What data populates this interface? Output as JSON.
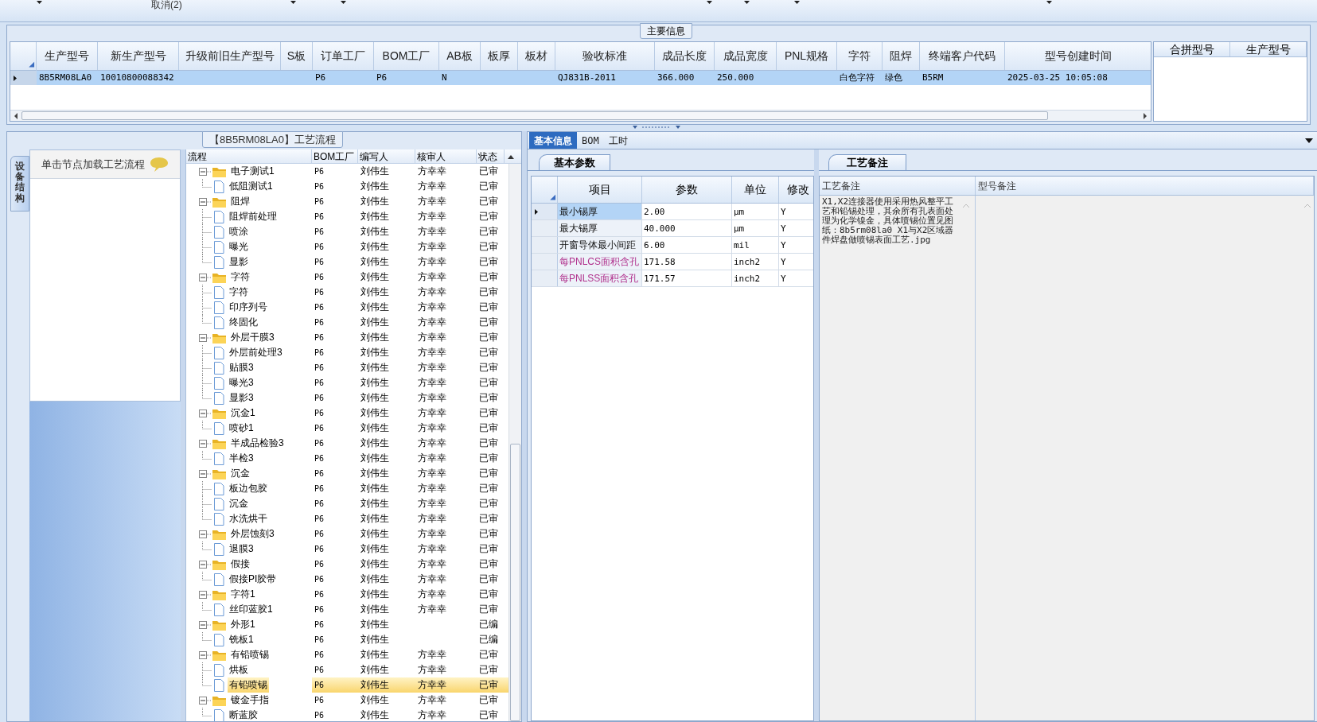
{
  "toolbar": {
    "cancel_label": "取消(2)"
  },
  "main_info": {
    "title": "主要信息",
    "columns": [
      "生产型号",
      "新生产型号",
      "升级前旧生产型号",
      "S板",
      "订单工厂",
      "BOM工厂",
      "AB板",
      "板厚",
      "板材",
      "验收标准",
      "成品长度",
      "成品宽度",
      "PNL规格",
      "字符",
      "阻焊",
      "终端客户代码",
      "型号创建时间"
    ],
    "rows": [
      {
        "selected": true,
        "cells": [
          "8B5RM08LA0",
          "10010800088342",
          "",
          "",
          "P6",
          "P6",
          "N",
          "",
          "",
          "QJ831B-2011",
          "366.000",
          "250.000",
          "",
          "白色字符",
          "绿色",
          "B5RM",
          "2025-03-25 10:05:08"
        ]
      }
    ],
    "side_columns": [
      "合拼型号",
      "生产型号"
    ]
  },
  "process": {
    "title": "【8B5RM08LA0】工艺流程",
    "side_tab": "设备结构",
    "hint": "单击节点加载工艺流程",
    "columns": [
      "流程",
      "BOM工厂",
      "编写人",
      "核审人",
      "状态"
    ],
    "nodes": [
      {
        "name": "电子测试1",
        "bom": "P6",
        "author": "刘伟生",
        "reviewer": "方幸幸",
        "status": "已审",
        "selected": false,
        "expanded": true,
        "children": [
          {
            "name": "低阻测试1",
            "bom": "P6",
            "author": "刘伟生",
            "reviewer": "方幸幸",
            "status": "已审",
            "selected": false
          }
        ]
      },
      {
        "name": "阻焊",
        "bom": "P6",
        "author": "刘伟生",
        "reviewer": "方幸幸",
        "status": "已审",
        "selected": false,
        "expanded": true,
        "children": [
          {
            "name": "阻焊前处理",
            "bom": "P6",
            "author": "刘伟生",
            "reviewer": "方幸幸",
            "status": "已审",
            "selected": false
          },
          {
            "name": "喷涂",
            "bom": "P6",
            "author": "刘伟生",
            "reviewer": "方幸幸",
            "status": "已审",
            "selected": false
          },
          {
            "name": "曝光",
            "bom": "P6",
            "author": "刘伟生",
            "reviewer": "方幸幸",
            "status": "已审",
            "selected": false
          },
          {
            "name": "显影",
            "bom": "P6",
            "author": "刘伟生",
            "reviewer": "方幸幸",
            "status": "已审",
            "selected": false
          }
        ]
      },
      {
        "name": "字符",
        "bom": "P6",
        "author": "刘伟生",
        "reviewer": "方幸幸",
        "status": "已审",
        "selected": false,
        "expanded": true,
        "children": [
          {
            "name": "字符",
            "bom": "P6",
            "author": "刘伟生",
            "reviewer": "方幸幸",
            "status": "已审",
            "selected": false
          },
          {
            "name": "印序列号",
            "bom": "P6",
            "author": "刘伟生",
            "reviewer": "方幸幸",
            "status": "已审",
            "selected": false
          },
          {
            "name": "终固化",
            "bom": "P6",
            "author": "刘伟生",
            "reviewer": "方幸幸",
            "status": "已审",
            "selected": false
          }
        ]
      },
      {
        "name": "外层干膜3",
        "bom": "P6",
        "author": "刘伟生",
        "reviewer": "方幸幸",
        "status": "已审",
        "selected": false,
        "expanded": true,
        "children": [
          {
            "name": "外层前处理3",
            "bom": "P6",
            "author": "刘伟生",
            "reviewer": "方幸幸",
            "status": "已审",
            "selected": false
          },
          {
            "name": "贴膜3",
            "bom": "P6",
            "author": "刘伟生",
            "reviewer": "方幸幸",
            "status": "已审",
            "selected": false
          },
          {
            "name": "曝光3",
            "bom": "P6",
            "author": "刘伟生",
            "reviewer": "方幸幸",
            "status": "已审",
            "selected": false
          },
          {
            "name": "显影3",
            "bom": "P6",
            "author": "刘伟生",
            "reviewer": "方幸幸",
            "status": "已审",
            "selected": false
          }
        ]
      },
      {
        "name": "沉金1",
        "bom": "P6",
        "author": "刘伟生",
        "reviewer": "方幸幸",
        "status": "已审",
        "selected": false,
        "expanded": true,
        "children": [
          {
            "name": "喷砂1",
            "bom": "P6",
            "author": "刘伟生",
            "reviewer": "方幸幸",
            "status": "已审",
            "selected": false
          }
        ]
      },
      {
        "name": "半成品检验3",
        "bom": "P6",
        "author": "刘伟生",
        "reviewer": "方幸幸",
        "status": "已审",
        "selected": false,
        "expanded": true,
        "children": [
          {
            "name": "半检3",
            "bom": "P6",
            "author": "刘伟生",
            "reviewer": "方幸幸",
            "status": "已审",
            "selected": false
          }
        ]
      },
      {
        "name": "沉金",
        "bom": "P6",
        "author": "刘伟生",
        "reviewer": "方幸幸",
        "status": "已审",
        "selected": false,
        "expanded": true,
        "children": [
          {
            "name": "板边包胶",
            "bom": "P6",
            "author": "刘伟生",
            "reviewer": "方幸幸",
            "status": "已审",
            "selected": false
          },
          {
            "name": "沉金",
            "bom": "P6",
            "author": "刘伟生",
            "reviewer": "方幸幸",
            "status": "已审",
            "selected": false
          },
          {
            "name": "水洗烘干",
            "bom": "P6",
            "author": "刘伟生",
            "reviewer": "方幸幸",
            "status": "已审",
            "selected": false
          }
        ]
      },
      {
        "name": "外层蚀刻3",
        "bom": "P6",
        "author": "刘伟生",
        "reviewer": "方幸幸",
        "status": "已审",
        "selected": false,
        "expanded": true,
        "children": [
          {
            "name": "退膜3",
            "bom": "P6",
            "author": "刘伟生",
            "reviewer": "方幸幸",
            "status": "已审",
            "selected": false
          }
        ]
      },
      {
        "name": "假接",
        "bom": "P6",
        "author": "刘伟生",
        "reviewer": "方幸幸",
        "status": "已审",
        "selected": false,
        "expanded": true,
        "children": [
          {
            "name": "假接PI胶带",
            "bom": "P6",
            "author": "刘伟生",
            "reviewer": "方幸幸",
            "status": "已审",
            "selected": false
          }
        ]
      },
      {
        "name": "字符1",
        "bom": "P6",
        "author": "刘伟生",
        "reviewer": "方幸幸",
        "status": "已审",
        "selected": false,
        "expanded": true,
        "children": [
          {
            "name": "丝印蓝胶1",
            "bom": "P6",
            "author": "刘伟生",
            "reviewer": "方幸幸",
            "status": "已审",
            "selected": false
          }
        ]
      },
      {
        "name": "外形1",
        "bom": "P6",
        "author": "刘伟生",
        "status": "已编",
        "selected": false,
        "expanded": true,
        "children": [
          {
            "name": "铣板1",
            "bom": "P6",
            "author": "刘伟生",
            "status": "已编",
            "selected": false
          }
        ]
      },
      {
        "name": "有铅喷锡",
        "bom": "P6",
        "author": "刘伟生",
        "reviewer": "方幸幸",
        "status": "已审",
        "selected": false,
        "expanded": true,
        "children": [
          {
            "name": "烘板",
            "bom": "P6",
            "author": "刘伟生",
            "reviewer": "方幸幸",
            "status": "已审",
            "selected": false
          },
          {
            "name": "有铅喷锡",
            "bom": "P6",
            "author": "刘伟生",
            "reviewer": "方幸幸",
            "status": "已审",
            "selected": true
          }
        ]
      },
      {
        "name": "镀金手指",
        "bom": "P6",
        "author": "刘伟生",
        "reviewer": "方幸幸",
        "status": "已审",
        "selected": false,
        "expanded": true,
        "children": [
          {
            "name": "断蓝胶",
            "bom": "P6",
            "author": "刘伟生",
            "reviewer": "方幸幸",
            "status": "已审",
            "selected": false
          }
        ]
      }
    ]
  },
  "detail_tabs": [
    {
      "label": "基本信息",
      "selected": true
    },
    {
      "label": "BOM",
      "selected": false
    },
    {
      "label": "工时",
      "selected": false
    }
  ],
  "params": {
    "tab": "基本参数",
    "columns": [
      "项目",
      "参数",
      "单位",
      "修改"
    ],
    "rows": [
      {
        "item": "最小锡厚",
        "value": "2.00",
        "unit": "μm",
        "modified": "Y",
        "selected": true,
        "emphasis": false
      },
      {
        "item": "最大锡厚",
        "value": "40.000",
        "unit": "μm",
        "modified": "Y",
        "selected": false,
        "emphasis": false
      },
      {
        "item": "开窗导体最小间距",
        "value": "6.00",
        "unit": "mil",
        "modified": "Y",
        "selected": false,
        "emphasis": false
      },
      {
        "item": "每PNLCS面积含孔",
        "value": "171.58",
        "unit": "inch2",
        "modified": "Y",
        "selected": false,
        "emphasis": true
      },
      {
        "item": "每PNLSS面积含孔",
        "value": "171.57",
        "unit": "inch2",
        "modified": "Y",
        "selected": false,
        "emphasis": true
      }
    ]
  },
  "remarks": {
    "tab": "工艺备注",
    "columns": [
      "工艺备注",
      "型号备注"
    ],
    "process_note": "X1,X2连接器使用采用热风整平工艺和铅锡处理，其余所有孔表面处理为化学镍金，具体喷锡位置见图纸：8b5rm08la0 X1与X2区域器件焊盘做喷锡表面工艺.jpg"
  }
}
